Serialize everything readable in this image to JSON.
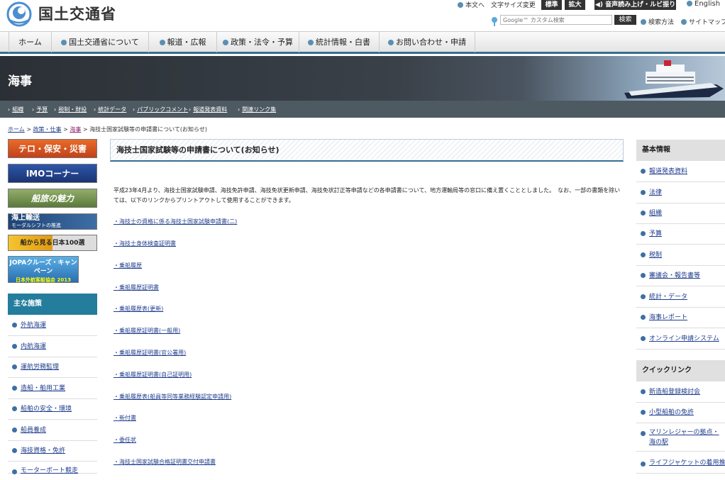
{
  "header": {
    "logo_text": "国土交通省",
    "util_links": {
      "honbun": "本文へ",
      "font_size_label": "文字サイズ変更",
      "standard": "標準",
      "enlarge": "拡大",
      "voice": "音声読み上げ・ルビ振り",
      "english": "English"
    },
    "search": {
      "placeholder": "Google™ カスタム検索",
      "button": "検索",
      "how_to": "検索方法",
      "sitemap": "サイトマップ"
    }
  },
  "nav": {
    "items": [
      "ホーム",
      "国土交通省について",
      "報道・広報",
      "政策・法令・予算",
      "統計情報・白書",
      "お問い合わせ・申請"
    ]
  },
  "banner": {
    "title": "海事"
  },
  "subnav": {
    "items": [
      "組織",
      "予算",
      "税制・財投",
      "統計データ",
      "パブリックコメント",
      "報道発表資料",
      "関連リンク集"
    ]
  },
  "breadcrumb": {
    "home": "ホーム",
    "sep": ">",
    "policy": "政策・仕事",
    "kaiji": "海事",
    "current": "海技士国家試験等の申請書について(お知らせ)"
  },
  "left_banners": [
    {
      "label": "テロ・保安・災害",
      "color": "#d9531e"
    },
    {
      "label": "IMOコーナー",
      "color": "#23418c"
    },
    {
      "label": "船旅の魅力",
      "color": "#6f8f4a"
    },
    {
      "label": "海上輸送",
      "sub": "モーダルシフトの推進",
      "color": "#264f86"
    },
    {
      "label": "船から見る日本100選",
      "color": "#f0b020"
    },
    {
      "label": "JOPAクルーズ・キャンペーン",
      "sub": "日本外航客船協会 2013",
      "color": "#2a6eb0"
    }
  ],
  "left_menu": {
    "title": "主な施策",
    "items": [
      "外航海運",
      "内航海運",
      "運航労務監理",
      "造船・舶用工業",
      "船舶の安全・環境",
      "船員養成",
      "海技資格・免許",
      "モーターボート競走"
    ]
  },
  "main": {
    "title": "海技士国家試験等の申請書について(お知らせ)",
    "intro": "平成23年4月より、海技士国家試験申請、海技免許申請、海技免状更新申請、海技免状訂正等申請などの各申請書について、地方運輸局等の窓口に備え置くこととしました。　なお、一部の書類を除いては、以下のリンクからプリントアウトして使用することができます。",
    "links": [
      "・海技士の資格に係る海技士国家試験申請書(二)",
      "・海技士身体検査証明書",
      "・乗船履歴",
      "・乗船履歴証明書",
      "・乗船履歴表(更新)",
      "・乗船履歴証明書(一般用)",
      "・乗船履歴証明書(官公署用)",
      "・乗船履歴証明書(自己証明用)",
      "・乗船履歴表(船員等同等業務経験認定申請用)",
      "・新付書",
      "・委任状",
      "・海技士国家試験合格証明書交付申請書"
    ]
  },
  "right_basic": {
    "title": "基本情報",
    "items": [
      "報道発表資料",
      "法律",
      "組織",
      "予算",
      "税制",
      "審議会・報告書等",
      "統計・データ",
      "海事レポート",
      "オンライン申請システム"
    ]
  },
  "right_quick": {
    "title": "クイックリンク",
    "items": [
      "新造船登録検討会",
      "小型船舶の免許",
      "マリンレジャーの拠点・海の駅",
      "ライフジャケットの着用推進"
    ]
  }
}
